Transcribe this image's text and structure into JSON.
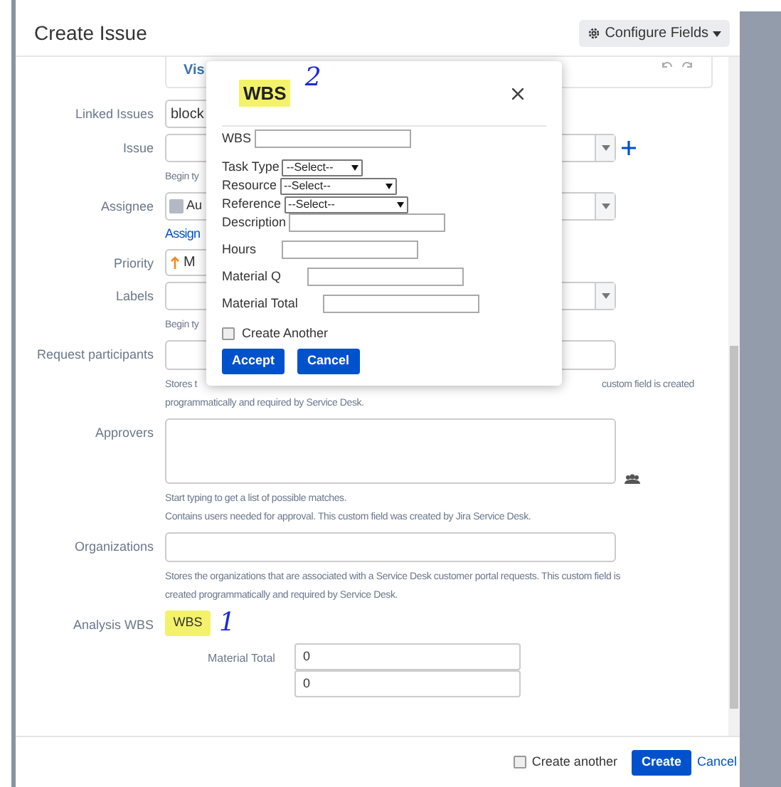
{
  "header": {
    "title": "Create Issue",
    "configure_button": "Configure Fields"
  },
  "form": {
    "editor_link": "Vis",
    "rows": [
      {
        "kind": "select",
        "label": "Linked Issues",
        "value": "block"
      },
      {
        "kind": "picker",
        "label": "Issue",
        "plus": true,
        "hint_lines": [
          [
            "Begin ty"
          ]
        ]
      },
      {
        "kind": "user",
        "label": "Assignee",
        "value": "Au",
        "link": "Assign"
      },
      {
        "kind": "priority",
        "label": "Priority",
        "value": "M"
      },
      {
        "kind": "picker",
        "label": "Labels",
        "hint_lines": [
          [
            "Begin ty"
          ]
        ]
      },
      {
        "kind": "text",
        "label": "Request participants",
        "hint_lines": [
          [
            "Stores t",
            "custom field is created"
          ],
          [
            "programmatically and required by Service Desk."
          ]
        ]
      },
      {
        "kind": "textarea",
        "label": "Approvers",
        "hint_lines": [
          [
            "Start typing to get a list of possible matches."
          ],
          [
            "Contains users needed for approval. This custom field was created by Jira Service Desk."
          ]
        ]
      },
      {
        "kind": "text",
        "label": "Organizations",
        "hint_lines": [
          [
            "Stores the organizations that are associated with a Service Desk customer portal requests. This custom field is"
          ],
          [
            "created programmatically and required by Service Desk."
          ]
        ]
      },
      {
        "kind": "button",
        "label": "Analysis WBS",
        "value": "WBS",
        "highlighted": true,
        "annotation": "1"
      }
    ],
    "material": {
      "label": "Material Total",
      "values": [
        "0",
        "0"
      ]
    }
  },
  "dialog": {
    "title": "WBS",
    "highlighted": true,
    "annotation": "2",
    "fields": [
      {
        "kind": "input",
        "label": "WBS"
      },
      {
        "kind": "select",
        "label": "Task Type",
        "value": "--Select--"
      },
      {
        "kind": "select",
        "label": "Resource",
        "value": "--Select--"
      },
      {
        "kind": "select",
        "label": "Reference",
        "value": "--Select--"
      },
      {
        "kind": "input",
        "label": "Description"
      },
      {
        "kind": "input",
        "label": "Hours"
      },
      {
        "kind": "input",
        "label": "Material Q"
      },
      {
        "kind": "input",
        "label": "Material Total"
      }
    ],
    "create_another": {
      "label": "Create Another",
      "checked": false
    },
    "buttons": [
      "Accept",
      "Cancel"
    ]
  },
  "footer": {
    "create_another": {
      "label": "Create another",
      "checked": false
    },
    "create_button": "Create",
    "cancel_link": "Cancel"
  }
}
